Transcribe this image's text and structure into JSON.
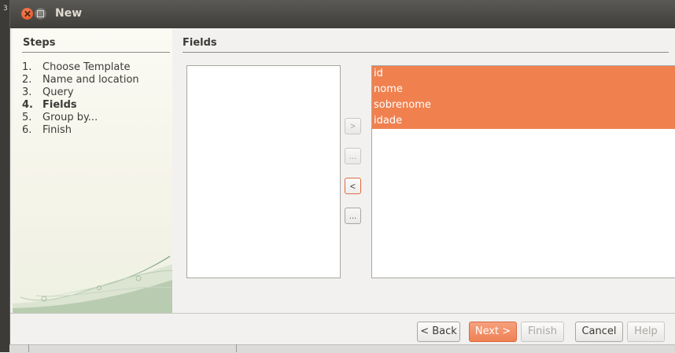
{
  "window": {
    "title": "New",
    "background_fragment": "3"
  },
  "steps": {
    "heading": "Steps",
    "items": [
      {
        "num": "1.",
        "label": "Choose Template"
      },
      {
        "num": "2.",
        "label": "Name and location"
      },
      {
        "num": "3.",
        "label": "Query"
      },
      {
        "num": "4.",
        "label": "Fields",
        "current": true
      },
      {
        "num": "5.",
        "label": "Group by..."
      },
      {
        "num": "6.",
        "label": "Finish"
      }
    ]
  },
  "fields": {
    "heading": "Fields",
    "available": [],
    "selected": [
      "id",
      "nome",
      "sobrenome",
      "idade"
    ]
  },
  "move_buttons": {
    "add_one": ">",
    "add_all": "...",
    "remove_one": "<",
    "remove_all": "..."
  },
  "buttons": {
    "back": "< Back",
    "next": "Next >",
    "finish": "Finish",
    "cancel": "Cancel",
    "help": "Help"
  },
  "colors": {
    "accent": "#f0814f",
    "titlebar": "#3f3e3a"
  }
}
